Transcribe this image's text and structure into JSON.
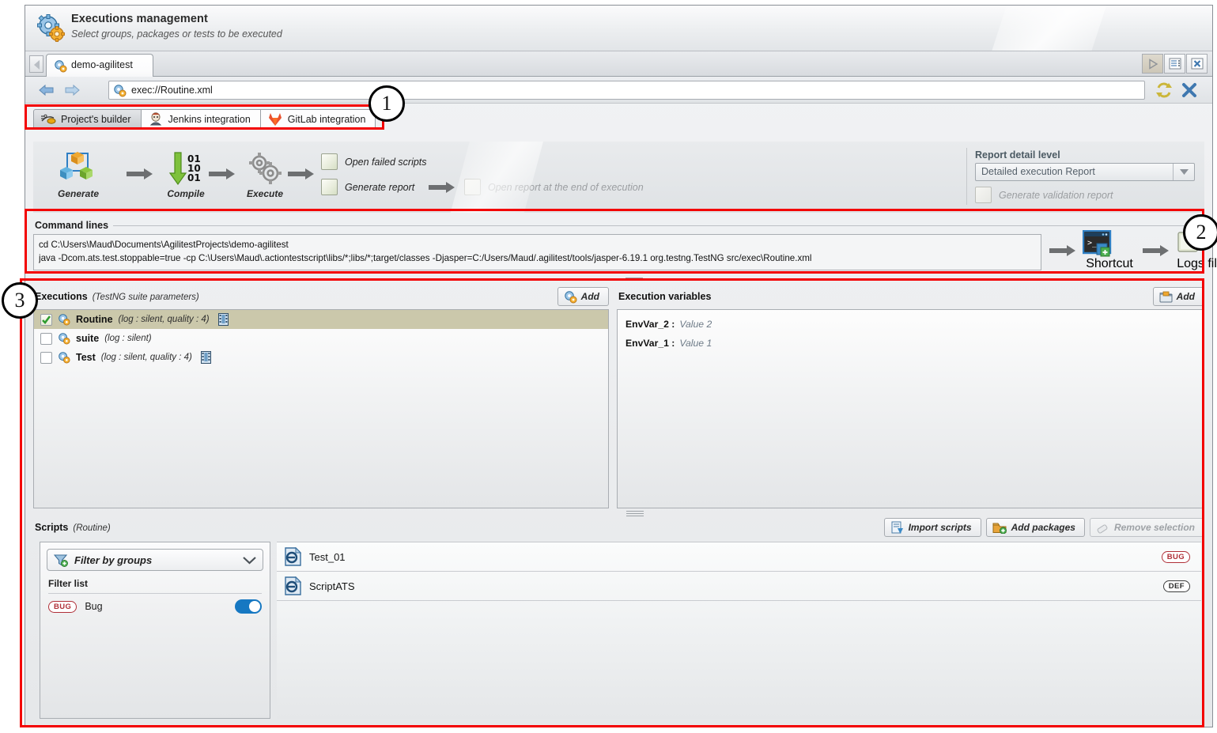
{
  "header": {
    "title": "Executions management",
    "subtitle": "Select groups, packages or tests to be executed",
    "icon": "gears-icon"
  },
  "tabstrip": {
    "tab_label": "demo-agilitest",
    "tab_icon": "gears-icon",
    "scroll_left_icon": "triangle-left-icon",
    "buttons": [
      {
        "name": "play-button",
        "icon": "play-icon"
      },
      {
        "name": "list-button",
        "icon": "list-icon"
      },
      {
        "name": "close-all-button",
        "icon": "close-grid-icon"
      }
    ]
  },
  "urlbar": {
    "back_icon": "arrow-left-icon",
    "forward_icon": "arrow-right-icon",
    "field_icon": "gears-icon",
    "value": "exec://Routine.xml",
    "refresh_icon": "refresh-icon",
    "close_icon": "close-x-icon"
  },
  "builder_tabs": [
    {
      "label": "Project's builder",
      "icon": "builder-icon",
      "selected": true
    },
    {
      "label": "Jenkins integration",
      "icon": "jenkins-icon",
      "selected": false
    },
    {
      "label": "GitLab integration",
      "icon": "gitlab-icon",
      "selected": false
    }
  ],
  "pipeline": {
    "steps": [
      {
        "label": "Generate",
        "icon": "cubes-icon"
      },
      {
        "label": "Compile",
        "icon": "down-arrow-binary-icon"
      },
      {
        "label": "Execute",
        "icon": "gears-icon"
      }
    ],
    "checkboxes": [
      {
        "label": "Open failed scripts",
        "checked": false,
        "disabled": false
      },
      {
        "label": "Generate report",
        "checked": false,
        "disabled": false
      },
      {
        "label": "Open  report at the end of execution",
        "checked": false,
        "disabled": true
      }
    ],
    "report_detail": {
      "title": "Report detail level",
      "selected": "Detailed execution Report",
      "validation_checkbox": "Generate validation report",
      "validation_checked": false,
      "validation_disabled": true
    }
  },
  "command_lines": {
    "title": "Command lines",
    "lines": [
      "cd C:\\Users\\Maud\\Documents\\AgilitestProjects\\demo-agilitest",
      "java -Dcom.ats.test.stoppable=true -cp C:\\Users\\Maud\\.actiontestscript\\libs/*;libs/*;target/classes -Djasper=C:/Users/Maud/.agilitest/tools/jasper-6.19.1 org.testng.TestNG src/exec\\Routine.xml"
    ],
    "shortcut_label": "Shortcut",
    "logs_label": "Logs file"
  },
  "executions": {
    "title": "Executions",
    "subtitle": "(TestNG suite parameters)",
    "add_label": "Add",
    "add_icon": "gears-icon",
    "rows": [
      {
        "name": "Routine",
        "meta": "(log : silent, quality : 4)",
        "checked": true,
        "selected": true,
        "has_video": true
      },
      {
        "name": "suite",
        "meta": "(log : silent)",
        "checked": false,
        "selected": false,
        "has_video": false
      },
      {
        "name": "Test",
        "meta": "(log : silent, quality : 4)",
        "checked": false,
        "selected": false,
        "has_video": true
      }
    ]
  },
  "execution_variables": {
    "title": "Execution variables",
    "add_label": "Add",
    "add_icon": "import-icon",
    "rows": [
      {
        "key": "EnvVar_2 :",
        "value": "Value 2"
      },
      {
        "key": "EnvVar_1 :",
        "value": "Value 1"
      }
    ]
  },
  "scripts": {
    "title": "Scripts",
    "subtitle": "(Routine)",
    "buttons": [
      {
        "label": "Import scripts",
        "icon": "import-scripts-icon",
        "disabled": false
      },
      {
        "label": "Add packages",
        "icon": "package-icon",
        "disabled": false
      },
      {
        "label": "Remove selection",
        "icon": "eraser-icon",
        "disabled": true
      }
    ],
    "filter": {
      "select_label": "Filter by groups",
      "select_icon": "funnel-icon",
      "list_title": "Filter list",
      "items": [
        {
          "badge": "BUG",
          "label": "Bug",
          "enabled": true
        }
      ]
    },
    "items": [
      {
        "name": "Test_01",
        "icon": "ats-script-icon",
        "badge": "BUG",
        "badge_style": "bug"
      },
      {
        "name": "ScriptATS",
        "icon": "ats-script-icon",
        "badge": "DEF",
        "badge_style": "def"
      }
    ]
  },
  "annotations": [
    {
      "number": "1"
    },
    {
      "number": "2"
    },
    {
      "number": "3"
    }
  ],
  "colors": {
    "annotation_red": "#f30000",
    "toggle_on": "#1678c2",
    "bug_badge": "#b03038",
    "selection": "#cbc8ab"
  }
}
